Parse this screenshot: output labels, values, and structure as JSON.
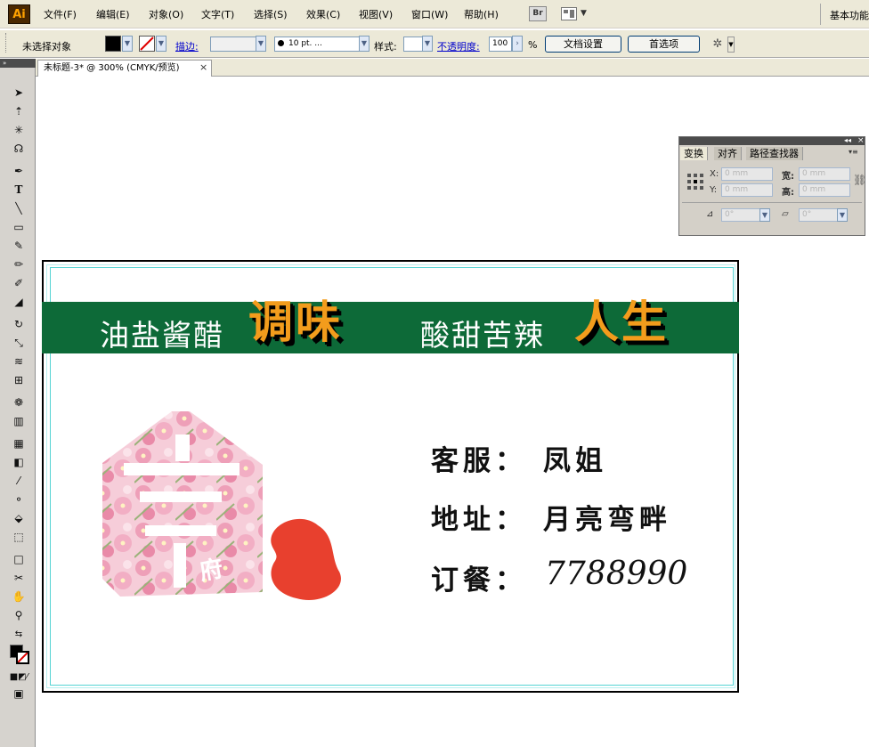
{
  "app": {
    "logo_text": "Ai"
  },
  "menu": {
    "items": [
      "文件(F)",
      "编辑(E)",
      "对象(O)",
      "文字(T)",
      "选择(S)",
      "效果(C)",
      "视图(V)",
      "窗口(W)",
      "帮助(H)"
    ],
    "bridge_label": "Br",
    "workspace_label": "基本功能"
  },
  "control_bar": {
    "selection_label": "未选择对象",
    "stroke_label": "描边:",
    "brush_value": "10 pt. ...",
    "style_label": "样式:",
    "opacity_label": "不透明度:",
    "opacity_value": "100",
    "opacity_unit": "%",
    "doc_setup_button": "文档设置",
    "preferences_button": "首选项"
  },
  "document": {
    "tab_title": "未标题-3* @ 300% (CMYK/预览)",
    "close_glyph": "×"
  },
  "card": {
    "slogan_part1": "油盐酱醋",
    "slogan_big1": "调味",
    "slogan_part2": "酸甜苦辣",
    "slogan_big2": "人生",
    "logo_badge_text": "府",
    "service_label": "客服：",
    "service_value": "凤姐",
    "address_label": "地址：",
    "address_value": "月亮弯畔",
    "order_label": "订餐：",
    "order_value": "7788990"
  },
  "transform_panel": {
    "tabs": [
      "变换",
      "对齐",
      "路径查找器"
    ],
    "x_label": "X:",
    "x_value": "0 mm",
    "y_label": "Y:",
    "y_value": "0 mm",
    "w_label": "宽:",
    "w_value": "0 mm",
    "h_label": "高:",
    "h_value": "0 mm",
    "rotate_value": "0°",
    "shear_value": "0°"
  },
  "colors": {
    "banner_green": "#0d6a38",
    "accent_orange": "#f39c1c",
    "logo_red": "#e8402e",
    "blossom_pink": "#f2aec4"
  }
}
